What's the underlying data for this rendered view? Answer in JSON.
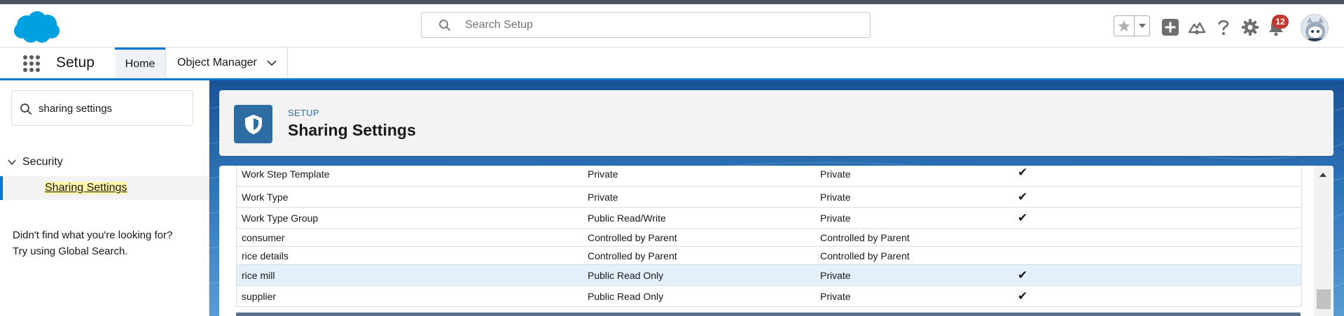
{
  "header": {
    "search_placeholder": "Search Setup",
    "notifications_count": "12"
  },
  "nav": {
    "app_name": "Setup",
    "tabs": [
      {
        "label": "Home",
        "active": true
      },
      {
        "label": "Object Manager",
        "active": false
      }
    ]
  },
  "sidebar": {
    "quickfind_value": "sharing settings",
    "section": "Security",
    "selected_item": "Sharing Settings",
    "not_found_line1": "Didn't find what you're looking for?",
    "not_found_line2": "Try using Global Search."
  },
  "page": {
    "eyebrow": "SETUP",
    "title": "Sharing Settings"
  },
  "table": {
    "rows": [
      {
        "object": "Work Step Template",
        "internal": "Private",
        "external": "Private",
        "hierarchy": "✔"
      },
      {
        "object": "Work Type",
        "internal": "Private",
        "external": "Private",
        "hierarchy": "✔"
      },
      {
        "object": "Work Type Group",
        "internal": "Public Read/Write",
        "external": "Private",
        "hierarchy": "✔"
      },
      {
        "object": "consumer",
        "internal": "Controlled by Parent",
        "external": "Controlled by Parent",
        "hierarchy": ""
      },
      {
        "object": "rice details",
        "internal": "Controlled by Parent",
        "external": "Controlled by Parent",
        "hierarchy": ""
      },
      {
        "object": "rice mill",
        "internal": "Public Read Only",
        "external": "Private",
        "hierarchy": "✔"
      },
      {
        "object": "supplier",
        "internal": "Public Read Only",
        "external": "Private",
        "hierarchy": "✔"
      }
    ]
  },
  "colors": {
    "brand_blue": "#0176d3",
    "cloud_logo": "#00a1e0",
    "setup_icon": "#2d6da3",
    "badge_red": "#c23934",
    "row_highlight": "#e3f0fb"
  }
}
